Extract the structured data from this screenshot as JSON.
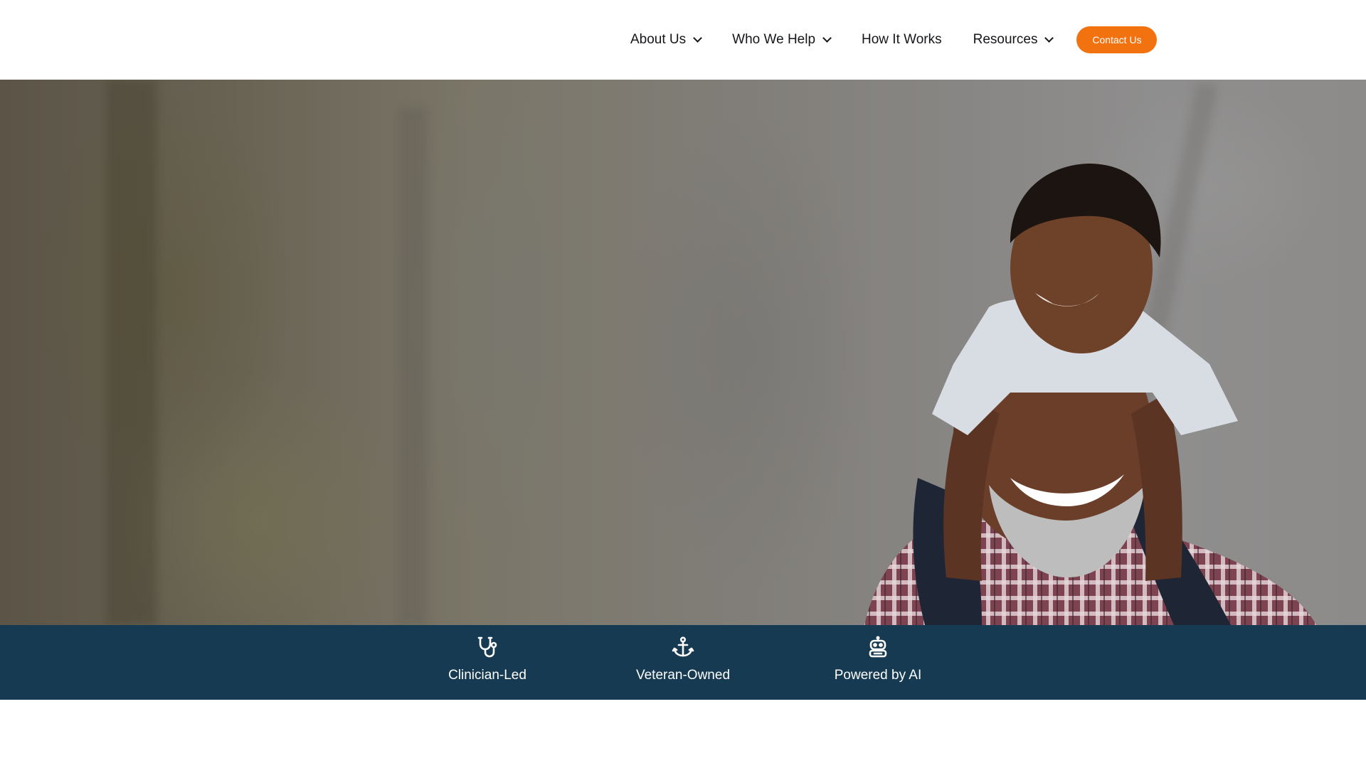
{
  "nav": {
    "items": [
      {
        "label": "About Us",
        "has_dropdown": true
      },
      {
        "label": "Who We Help",
        "has_dropdown": true
      },
      {
        "label": "How It Works",
        "has_dropdown": false
      },
      {
        "label": "Resources",
        "has_dropdown": true
      }
    ],
    "contact_label": "Contact Us"
  },
  "colors": {
    "accent": "#f2720f",
    "band": "#163a52",
    "nav_text": "#14161a"
  },
  "hero": {
    "image": "photo of smiling grandfather carrying young boy on his shoulders outdoors"
  },
  "features": [
    {
      "icon": "stethoscope-icon",
      "label": "Clinician-Led"
    },
    {
      "icon": "anchor-icon",
      "label": "Veteran-Owned"
    },
    {
      "icon": "robot-icon",
      "label": "Powered by AI"
    }
  ]
}
